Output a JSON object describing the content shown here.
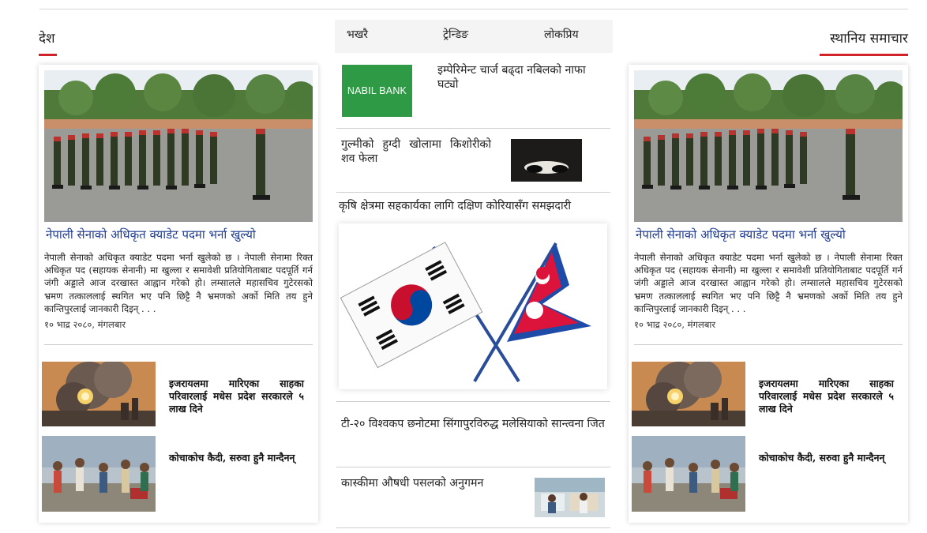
{
  "tabs": [
    "भखरै",
    "ट्रेन्डिङ",
    "लोकप्रिय"
  ],
  "left_section": {
    "title": "देश",
    "feature": {
      "headline": "नेपाली सेनाको अधिकृत क्याडेट पदमा भर्ना खुल्यो",
      "excerpt": "नेपाली सेनाको अधिकृत क्याडेट पदमा भर्ना खुलेको छ । नेपाली सेनामा रिक्त अधिकृत पद (सहायक सेनानी) मा खुल्ला र समावेशी प्रतियोगिताबाट पदपूर्ति गर्न जंगी अड्डाले आज दरखास्त आह्वान गरेको हो। लम्सालले महासचिव गुटेरसको भ्रमण तत्काललाई स्थगित भए पनि छिट्टै नै भ्रमणको अर्को मिति तय हुने कान्तिपुरलाई जानकारी दिइन् . . .",
      "date": "१० भाद्र २०८०, मंगलबार"
    },
    "mini": [
      {
        "title": "इजरायलमा मारिएका साहका परिवारलाई मधेस प्रदेश सरकारले ५ लाख दिने"
      },
      {
        "title": "कोचाकोच कैदी, सरुवा हुनै मान्दैनन्"
      }
    ]
  },
  "right_section": {
    "title": "स्थानिय समाचार",
    "feature": {
      "headline": "नेपाली सेनाको अधिकृत क्याडेट पदमा भर्ना खुल्यो",
      "excerpt": "नेपाली सेनाको अधिकृत क्याडेट पदमा भर्ना खुलेको छ । नेपाली सेनामा रिक्त अधिकृत पद (सहायक सेनानी) मा खुल्ला र समावेशी प्रतियोगिताबाट पदपूर्ति गर्न जंगी अड्डाले आज दरखास्त आह्वान गरेको हो। लम्सालले महासचिव गुटेरसको भ्रमण तत्काललाई स्थगित भए पनि छिट्टै नै भ्रमणको अर्को मिति तय हुने कान्तिपुरलाई जानकारी दिइन् . . .",
      "date": "१० भाद्र २०८०, मंगलबार"
    },
    "mini": [
      {
        "title": "इजरायलमा मारिएका साहका परिवारलाई मधेस प्रदेश सरकारले ५ लाख दिने"
      },
      {
        "title": "कोचाकोच कैदी, सरुवा हुनै मान्दैनन्"
      }
    ]
  },
  "center": {
    "items": [
      {
        "title": "इम्पेरिमेन्ट चार्ज बढ्दा नबिलको नाफा घट्यो",
        "logo_text": "NABIL BANK"
      },
      {
        "title": "गुल्मीको हुग्दी खोलामा किशोरीको शव फेला"
      },
      {
        "title": "कृषि क्षेत्रमा सहकार्यका लागि दक्षिण कोरियासँग समझदारी"
      },
      {
        "title": "टी-२० विश्वकप छनोटमा सिंगापुरविरुद्ध मलेसियाको सान्त्वना जित"
      },
      {
        "title": "कास्कीमा औषधी पसलको अनुगमन"
      }
    ]
  },
  "colors": {
    "accent": "#d2232a",
    "headline": "#1f3b8f",
    "nabil_green": "#2e9a45",
    "tab_bg": "#f4f4f4"
  }
}
